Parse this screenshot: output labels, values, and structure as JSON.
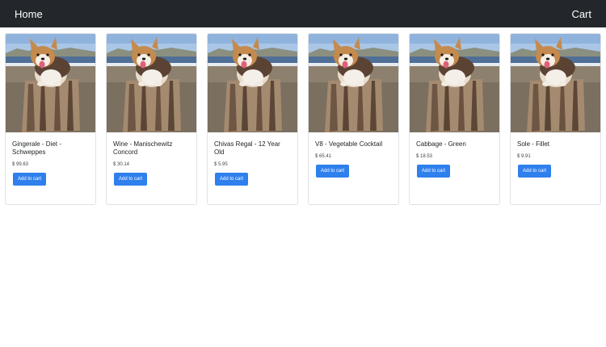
{
  "navbar": {
    "home_label": "Home",
    "cart_label": "Cart"
  },
  "products": [
    {
      "title": "Gingerale - Diet - Schweppes",
      "price": "$ 99.63",
      "button_label": "Add to cart"
    },
    {
      "title": "Wine - Manischewitz Concord",
      "price": "$ 30.14",
      "button_label": "Add to cart"
    },
    {
      "title": "Chivas Regal - 12 Year Old",
      "price": "$ 5.95",
      "button_label": "Add to cart"
    },
    {
      "title": "V8 - Vegetable Cocktail",
      "price": "$ 65.41",
      "button_label": "Add to cart"
    },
    {
      "title": "Cabbage - Green",
      "price": "$ 18.53",
      "button_label": "Add to cart"
    },
    {
      "title": "Sole - Fillet",
      "price": "$ 9.91",
      "button_label": "Add to cart"
    }
  ]
}
